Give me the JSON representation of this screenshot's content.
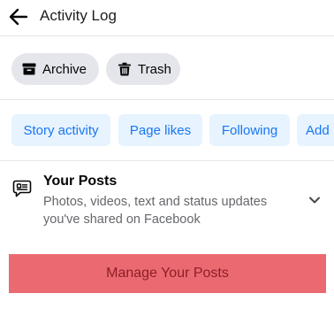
{
  "header": {
    "title": "Activity Log",
    "back_icon": "arrow-left-icon"
  },
  "actions": [
    {
      "label": "Archive",
      "icon": "archive-box-icon"
    },
    {
      "label": "Trash",
      "icon": "trash-can-icon"
    }
  ],
  "filter_chips": [
    {
      "label": "Story activity"
    },
    {
      "label": "Page likes"
    },
    {
      "label": "Following"
    },
    {
      "label": "Add"
    }
  ],
  "section": {
    "title": "Your Posts",
    "description": "Photos, videos, text and status updates you've shared on Facebook",
    "icon": "posts-chat-icon",
    "expand_icon": "chevron-down-icon"
  },
  "manage_button": {
    "label": "Manage Your Posts"
  },
  "colors": {
    "chip_bg": "#e7f3ff",
    "chip_text": "#1877f2",
    "pill_bg": "#e4e6eb",
    "button_bg": "#eb6a72",
    "button_text": "#8e1d26"
  }
}
